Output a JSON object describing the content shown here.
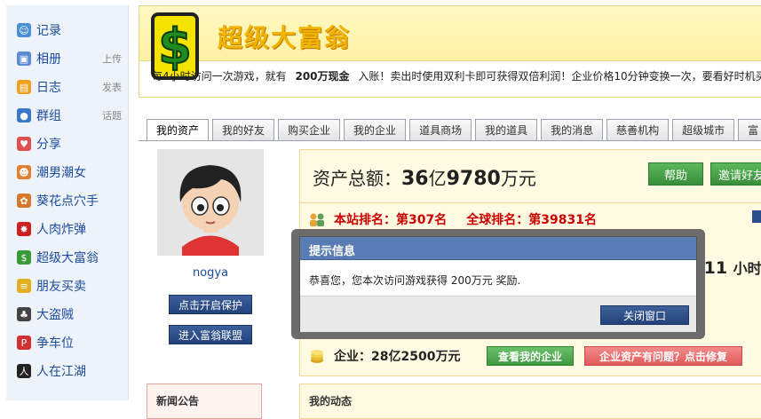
{
  "sidebar": {
    "items": [
      {
        "label": "记录",
        "icon": "speech-bubble-icon",
        "extra": "",
        "color": "#4a90d9"
      },
      {
        "label": "相册",
        "icon": "photo-album-icon",
        "extra": "上传",
        "color": "#5b8dd6"
      },
      {
        "label": "日志",
        "icon": "notebook-icon",
        "extra": "发表",
        "color": "#f0a020"
      },
      {
        "label": "群组",
        "icon": "group-icon",
        "extra": "话题",
        "color": "#3a78c8"
      },
      {
        "label": "分享",
        "icon": "heart-share-icon",
        "extra": "",
        "color": "#e05050"
      },
      {
        "label": "潮男潮女",
        "icon": "people-icon",
        "extra": "",
        "color": "#e08030"
      },
      {
        "label": "葵花点穴手",
        "icon": "sunflower-icon",
        "extra": "",
        "color": "#d47a2a"
      },
      {
        "label": "人肉炸弹",
        "icon": "bomb-icon",
        "extra": "",
        "color": "#cc2020"
      },
      {
        "label": "超级大富翁",
        "icon": "dollar-icon",
        "extra": "",
        "color": "#3a9a3a"
      },
      {
        "label": "朋友买卖",
        "icon": "coins-icon",
        "extra": "",
        "color": "#e0b020"
      },
      {
        "label": "大盗贼",
        "icon": "thief-icon",
        "extra": "",
        "color": "#444444"
      },
      {
        "label": "争车位",
        "icon": "parking-icon",
        "extra": "",
        "color": "#d03030"
      },
      {
        "label": "人在江湖",
        "icon": "swordsman-icon",
        "extra": "",
        "color": "#222222"
      }
    ]
  },
  "header": {
    "title": "超级大富翁",
    "notice_pre": "每4小时访问一次游戏，就有",
    "notice_bold": "200万现金",
    "notice_post": "入账！卖出时使用双利卡即可获得双倍利润！企业价格10分钟变换一次，要看好时机买"
  },
  "tabs": [
    "我的资产",
    "我的好友",
    "购买企业",
    "我的企业",
    "道具商场",
    "我的道具",
    "我的消息",
    "慈善机构",
    "超级城市",
    "富"
  ],
  "profile": {
    "username": "nogya",
    "protect_button": "点击开启保护",
    "alliance_button": "进入富翁联盟",
    "news_title": "新闻公告"
  },
  "assets": {
    "total_label": "资产总额：",
    "total_value_big1": "36",
    "total_unit1": "亿",
    "total_value_big2": "9780",
    "total_unit2": "万元",
    "help_button": "帮助",
    "invite_button": "邀请好友",
    "site_rank": "本站排名：第307名",
    "global_rank": "全球排名：第39831名",
    "time_fragment": ":11",
    "time_unit": "小时",
    "company_label": "企业：28亿2500万元",
    "view_company_button": "查看我的企业",
    "fix_button": "企业资产有问题？点击修复",
    "news_right_title": "我的动态"
  },
  "dialog": {
    "title": "提示信息",
    "message": "恭喜您，您本次访问游戏获得  200万元  奖励.",
    "close_button": "关闭窗口"
  },
  "colors": {
    "accent_blue": "#2b4b8a",
    "header_yellow": "#fff1a3",
    "rank_red": "#cc0000",
    "button_green": "#3a8e3a",
    "fix_red": "#e86a6a"
  }
}
